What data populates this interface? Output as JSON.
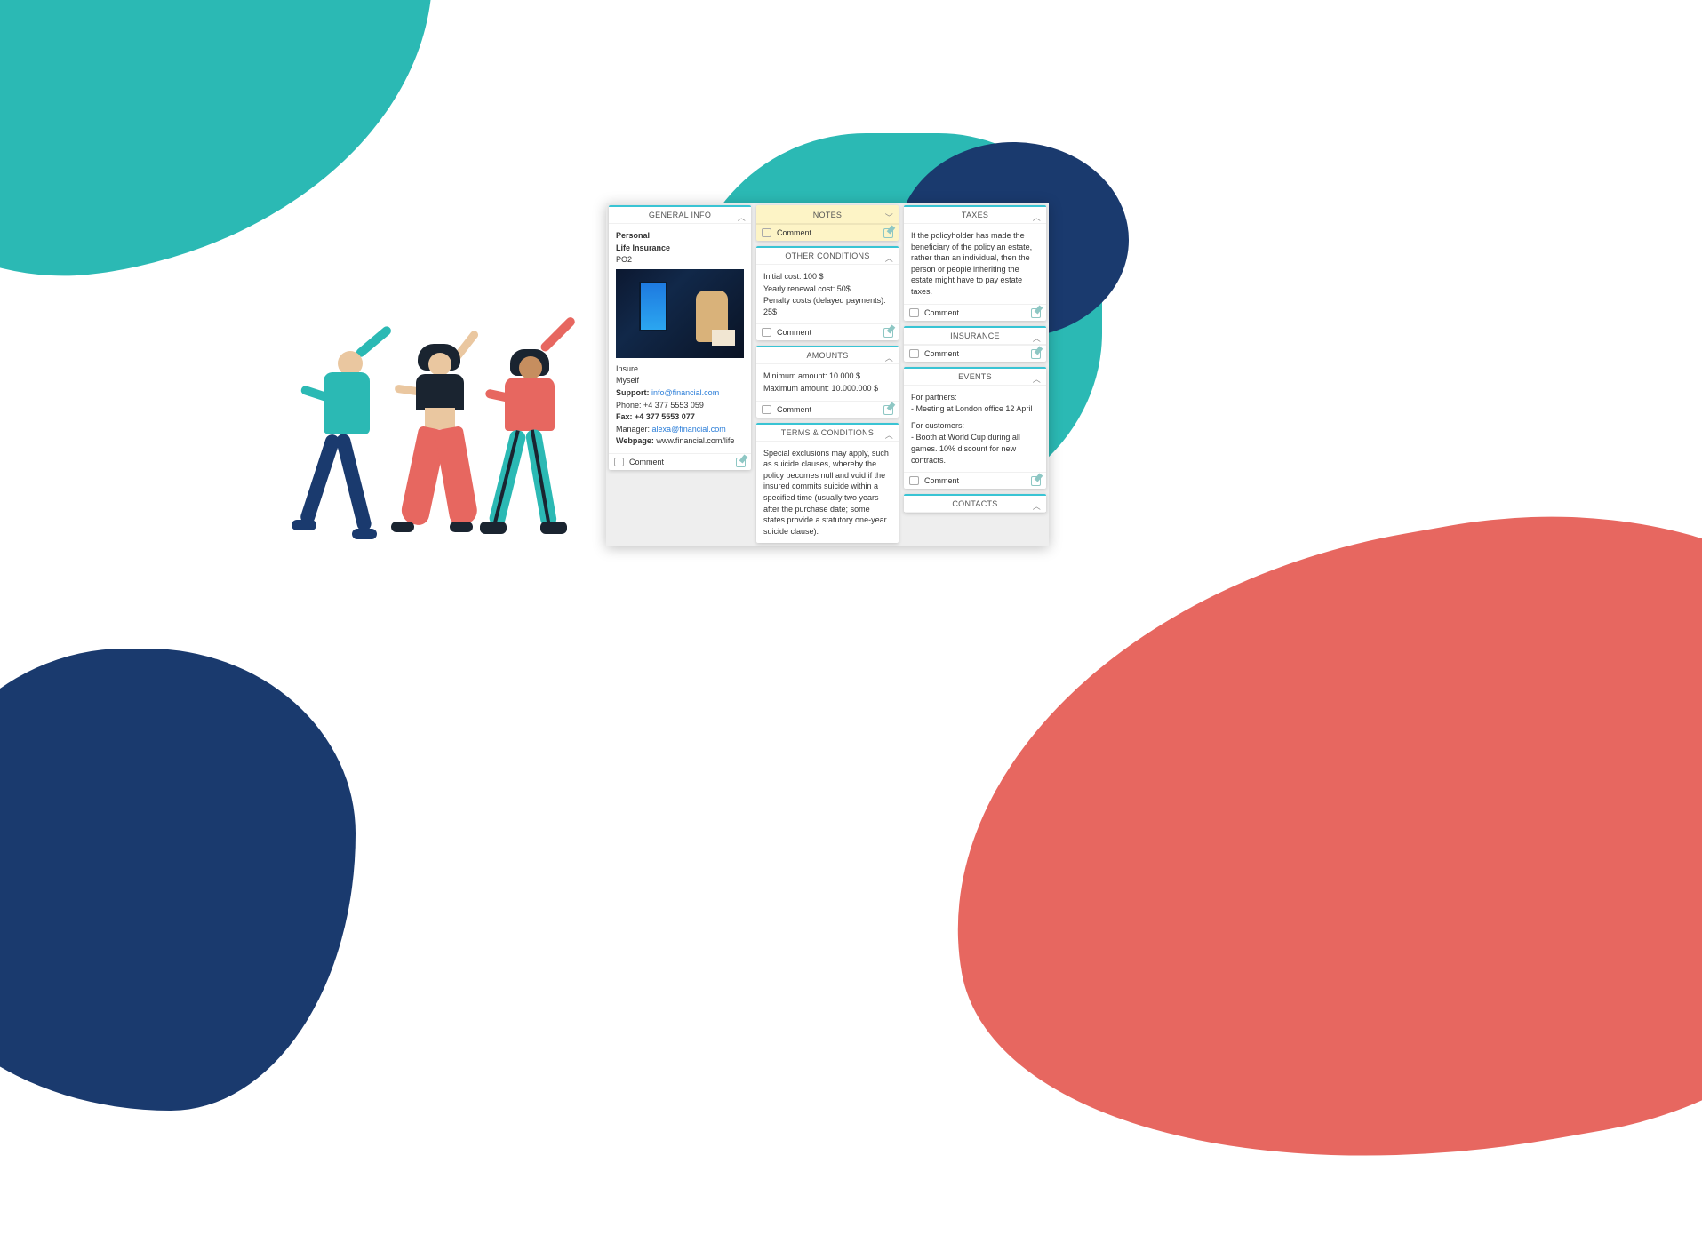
{
  "generalInfo": {
    "title": "GENERAL INFO",
    "personal": "Personal",
    "lifeInsurance": "Life Insurance",
    "code": "PO2",
    "insure": "Insure",
    "myself": "Myself",
    "supportLabel": "Support:",
    "supportEmail": "info@financial.com",
    "phoneLabel": "Phone:",
    "phone": "+4 377 5553 059",
    "faxLabel": "Fax: +4 377 5553 077",
    "managerLabel": "Manager:",
    "managerEmail": "alexa@financial.com",
    "webpageLabel": "Webpage:",
    "webpage": "www.financial.com/life",
    "comment": "Comment"
  },
  "notes": {
    "title": "NOTES",
    "comment": "Comment"
  },
  "other": {
    "title": "OTHER CONDITIONS",
    "l1": "Initial cost: 100 $",
    "l2": "Yearly renewal cost: 50$",
    "l3": "Penalty costs (delayed payments): 25$",
    "comment": "Comment"
  },
  "amounts": {
    "title": "AMOUNTS",
    "l1": "Minimum amount: 10.000 $",
    "l2": "Maximum amount: 10.000.000 $",
    "comment": "Comment"
  },
  "terms": {
    "title": "TERMS & CONDITIONS",
    "body": "Special exclusions may apply, such as suicide clauses, whereby the policy becomes null and void if the insured commits suicide within a specified time (usually two years after the purchase date; some states provide a statutory one-year suicide clause)."
  },
  "taxes": {
    "title": "TAXES",
    "body": "If the policyholder has made the beneficiary of the policy an estate, rather than an individual, then the person or people inheriting the estate might have to pay estate taxes.",
    "comment": "Comment"
  },
  "insurance": {
    "title": "INSURANCE",
    "comment": "Comment"
  },
  "events": {
    "title": "EVENTS",
    "h1": "For partners:",
    "l1": "- Meeting at London office 12 April",
    "h2": "For customers:",
    "l2": "- Booth at World Cup during all games. 10% discount for new contracts.",
    "comment": "Comment"
  },
  "contacts": {
    "title": "CONTACTS"
  }
}
